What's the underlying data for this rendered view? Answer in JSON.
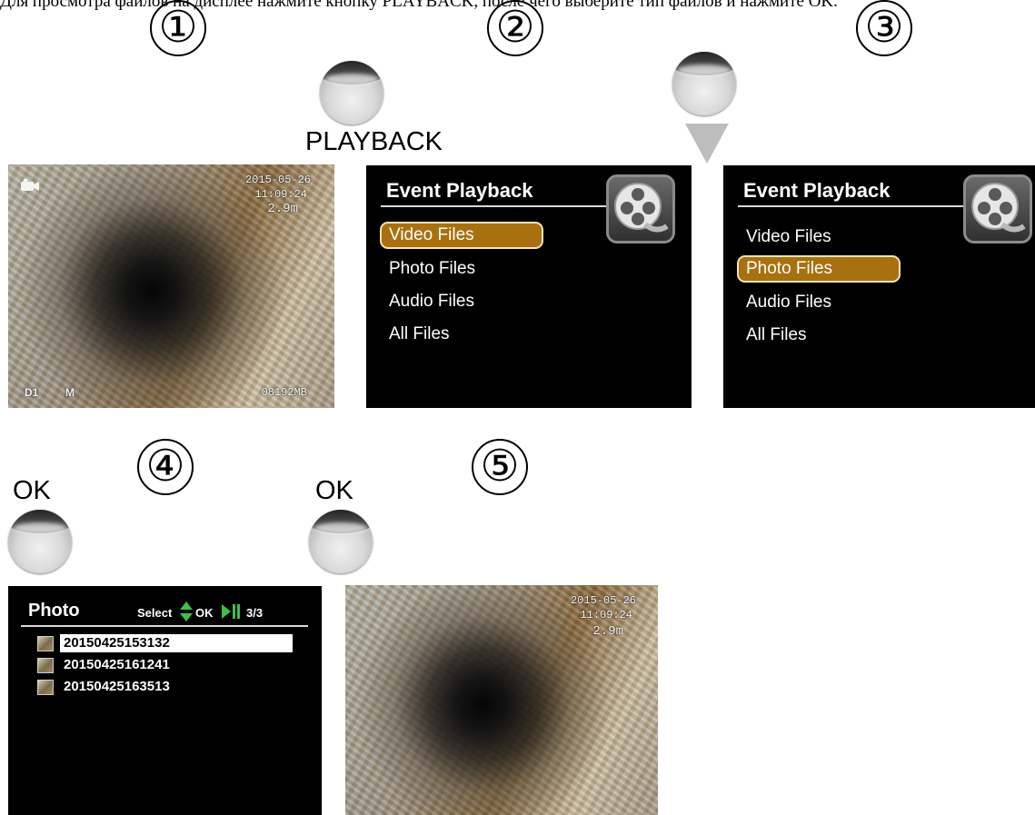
{
  "caption": "Для просмотра файлов на дисплее нажмите кнопку PLAYBACK, после чего выберите тип файлов и нажмите OK.",
  "steps": [
    "①",
    "②",
    "③",
    "④",
    "⑤"
  ],
  "buttons": {
    "playback_label": "PLAYBACK",
    "ok_label_1": "OK",
    "ok_label_2": "OK"
  },
  "live_view": {
    "date": "2015-05-26",
    "time": "11:09:24",
    "distance": "2.9m",
    "mode": "D1",
    "memory_icon": "M",
    "storage": "08192MB",
    "camera_icon": "camera-icon"
  },
  "menu_screen_1": {
    "title": "Event Playback",
    "items": [
      "Video Files",
      "Photo Files",
      "Audio Files",
      "All Files"
    ],
    "selected_index": 0,
    "icon": "film-reel-icon"
  },
  "menu_screen_2": {
    "title": "Event Playback",
    "items": [
      "Video Files",
      "Photo Files",
      "Audio Files",
      "All Files"
    ],
    "selected_index": 1,
    "icon": "film-reel-icon"
  },
  "photo_list": {
    "title": "Photo",
    "select_label": "Select",
    "ok_label": "OK",
    "counter": "3/3",
    "files": [
      "20150425153132",
      "20150425161241",
      "20150425163513"
    ],
    "selected_index": 0,
    "colors": {
      "select_arrows": "#3fbf4a",
      "play_pause": "#3fbf4a"
    }
  },
  "photo_view": {
    "date": "2015-05-26",
    "time": "11:09:24",
    "distance": "2.9m"
  },
  "colors": {
    "menu_highlight": "#a8700e",
    "screen_bg": "#000000"
  }
}
